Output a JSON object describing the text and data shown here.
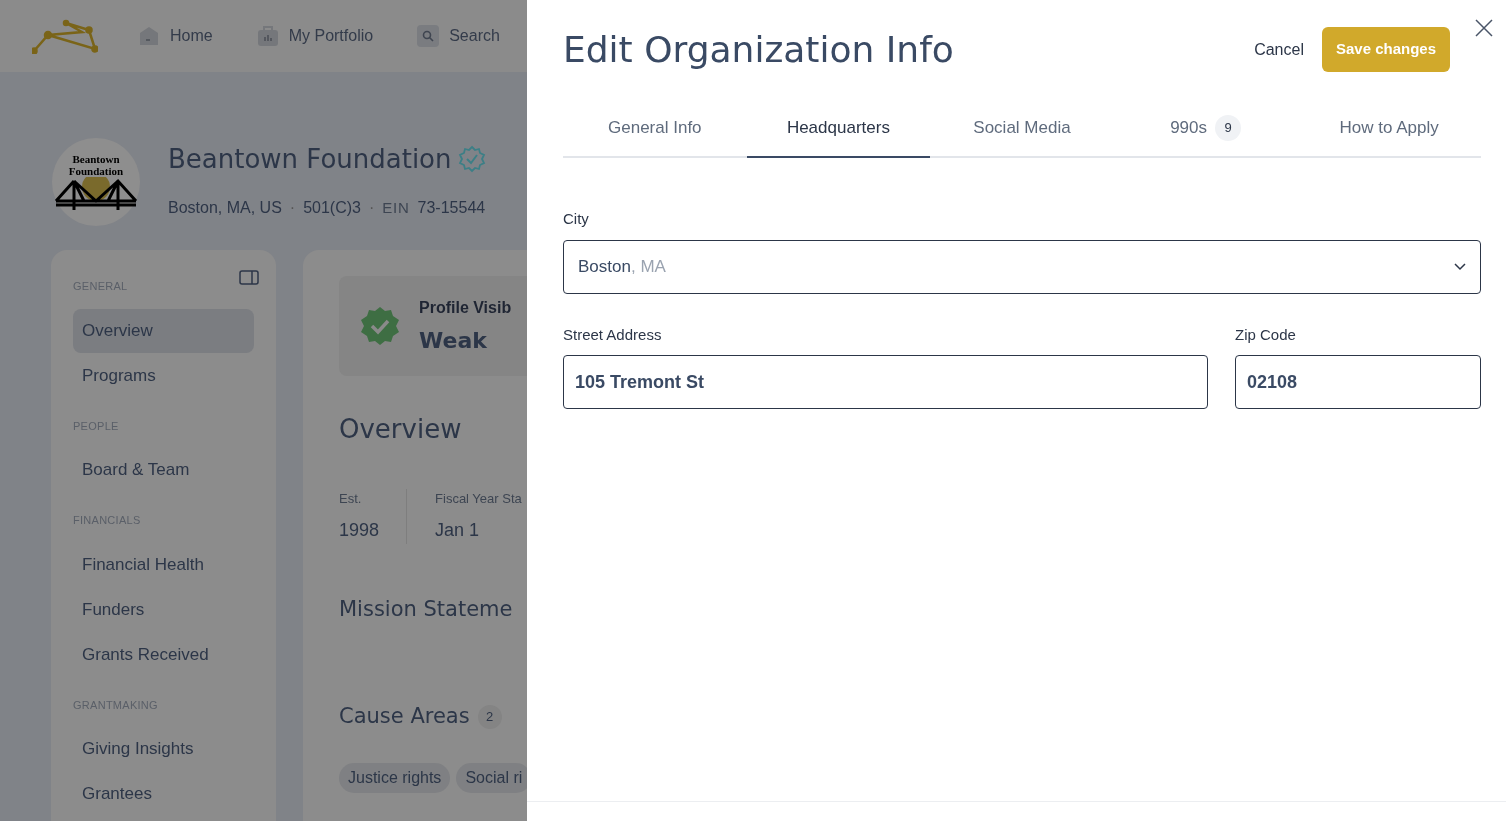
{
  "nav": {
    "items": [
      {
        "label": "Home",
        "kind": "home"
      },
      {
        "label": "My Portfolio",
        "kind": "portfolio"
      },
      {
        "label": "Search",
        "kind": "search"
      }
    ]
  },
  "org": {
    "logo_text": [
      "Beantown",
      "Foundation"
    ],
    "name": "Beantown Foundation",
    "location": "Boston, MA, US",
    "separator_1": "·",
    "type": "501(C)3",
    "separator_2": "·",
    "ein_label": "EIN",
    "ein": "73-15544"
  },
  "sidebar": {
    "sections": [
      {
        "heading": "GENERAL",
        "items": [
          {
            "label": "Overview",
            "selected": true
          },
          {
            "label": "Programs",
            "selected": false
          }
        ]
      },
      {
        "heading": "PEOPLE",
        "items": [
          {
            "label": "Board & Team",
            "selected": false
          }
        ]
      },
      {
        "heading": "FINANCIALS",
        "items": [
          {
            "label": "Financial Health",
            "selected": false
          },
          {
            "label": "Funders",
            "selected": false
          },
          {
            "label": "Grants Received",
            "selected": false
          }
        ]
      },
      {
        "heading": "GRANTMAKING",
        "items": [
          {
            "label": "Giving Insights",
            "selected": false
          },
          {
            "label": "Grantees",
            "selected": false
          }
        ]
      }
    ]
  },
  "content": {
    "visibility": {
      "title": "Profile Visib",
      "value": "Weak"
    },
    "heading": "Overview",
    "facts": [
      {
        "label": "Est.",
        "value": "1998"
      },
      {
        "label": "Fiscal Year Sta",
        "value": "Jan 1"
      }
    ],
    "mission_heading": "Mission Stateme",
    "cause_heading": "Cause Areas",
    "cause_count": "2",
    "tags": [
      "Justice rights",
      "Social ri"
    ]
  },
  "modal": {
    "title": "Edit Organization Info",
    "cancel": "Cancel",
    "save": "Save changes",
    "tabs": [
      {
        "label": "General Info",
        "selected": false
      },
      {
        "label": "Headquarters",
        "selected": true
      },
      {
        "label": "Social Media",
        "selected": false
      },
      {
        "label": "990s",
        "badge": "9",
        "selected": false
      },
      {
        "label": "How to Apply",
        "selected": false
      }
    ],
    "city": {
      "label": "City",
      "value": "Boston",
      "suffix": ", MA"
    },
    "street": {
      "label": "Street Address",
      "value": "105 Tremont St"
    },
    "zip": {
      "label": "Zip Code",
      "value": "02108"
    }
  }
}
